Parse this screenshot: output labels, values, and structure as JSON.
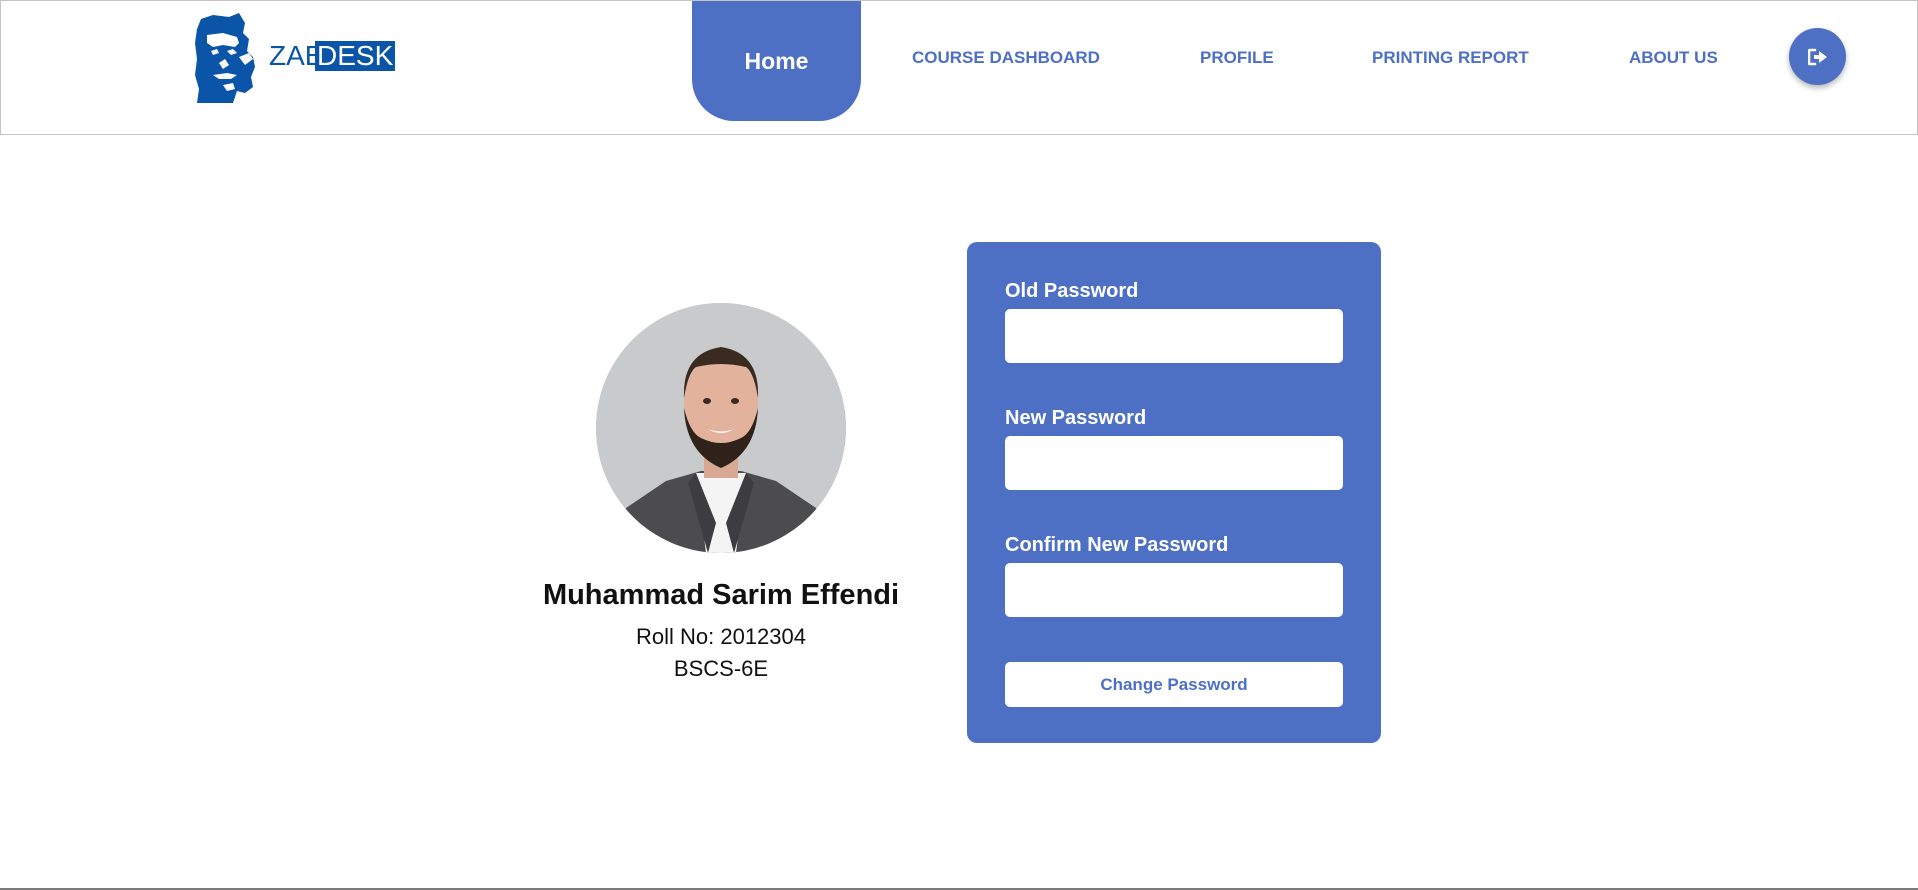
{
  "brand": {
    "logo_part1": "ZAB",
    "logo_part2": "DESK",
    "color": "#0b55a8",
    "icon": "founder-portrait-logo"
  },
  "nav": {
    "active_label": "Home",
    "items": [
      {
        "label": "COURSE DASHBOARD"
      },
      {
        "label": "PROFILE"
      },
      {
        "label": "PRINTING REPORT"
      },
      {
        "label": "ABOUT US"
      }
    ],
    "logout_icon": "sign-out-icon",
    "accent": "#4d6fc4"
  },
  "profile": {
    "name": "Muhammad Sarim Effendi",
    "roll": "Roll No: 2012304",
    "program": "BSCS-6E",
    "avatar_icon": "user-photo"
  },
  "password_form": {
    "old_label": "Old Password",
    "old_value": "",
    "new_label": "New Password",
    "new_value": "",
    "confirm_label": "Confirm New Password",
    "confirm_value": "",
    "submit_label": "Change Password"
  }
}
